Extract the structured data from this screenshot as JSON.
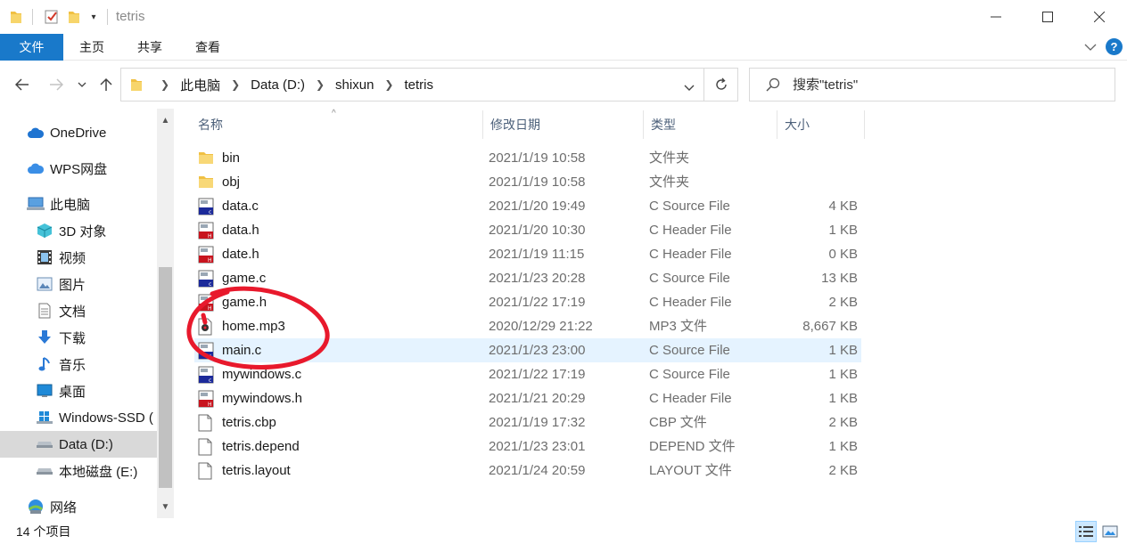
{
  "window": {
    "title": "tetris",
    "minimize_icon": "minimize-icon",
    "maximize_icon": "maximize-icon",
    "close_icon": "close-icon"
  },
  "ribbon": {
    "tabs": [
      {
        "label": "文件"
      },
      {
        "label": "主页"
      },
      {
        "label": "共享"
      },
      {
        "label": "查看"
      }
    ]
  },
  "address": {
    "crumbs": [
      "此电脑",
      "Data (D:)",
      "shixun",
      "tetris"
    ]
  },
  "search": {
    "placeholder": "搜索\"tetris\""
  },
  "sidebar": {
    "items": [
      {
        "label": "OneDrive",
        "icon": "cloud-icon"
      },
      {
        "label": "WPS网盘",
        "icon": "cloud-icon"
      },
      {
        "label": "此电脑",
        "icon": "computer-icon"
      },
      {
        "label": "3D 对象",
        "icon": "cube-icon"
      },
      {
        "label": "视频",
        "icon": "film-icon"
      },
      {
        "label": "图片",
        "icon": "picture-icon"
      },
      {
        "label": "文档",
        "icon": "document-icon"
      },
      {
        "label": "下载",
        "icon": "download-icon"
      },
      {
        "label": "音乐",
        "icon": "music-icon"
      },
      {
        "label": "桌面",
        "icon": "desktop-icon"
      },
      {
        "label": "Windows-SSD (",
        "icon": "windows-drive-icon"
      },
      {
        "label": "Data (D:)",
        "icon": "drive-icon"
      },
      {
        "label": "本地磁盘 (E:)",
        "icon": "drive-icon"
      },
      {
        "label": "网络",
        "icon": "network-icon"
      }
    ]
  },
  "columns": {
    "name": "名称",
    "date": "修改日期",
    "type": "类型",
    "size": "大小"
  },
  "files": [
    {
      "name": "bin",
      "date": "2021/1/19 10:58",
      "type": "文件夹",
      "size": "",
      "icon": "folder-icon"
    },
    {
      "name": "obj",
      "date": "2021/1/19 10:58",
      "type": "文件夹",
      "size": "",
      "icon": "folder-icon"
    },
    {
      "name": "data.c",
      "date": "2021/1/20 19:49",
      "type": "C Source File",
      "size": "4 KB",
      "icon": "c-source-icon"
    },
    {
      "name": "data.h",
      "date": "2021/1/20 10:30",
      "type": "C Header File",
      "size": "1 KB",
      "icon": "c-header-icon"
    },
    {
      "name": "date.h",
      "date": "2021/1/19 11:15",
      "type": "C Header File",
      "size": "0 KB",
      "icon": "c-header-icon"
    },
    {
      "name": "game.c",
      "date": "2021/1/23 20:28",
      "type": "C Source File",
      "size": "13 KB",
      "icon": "c-source-icon"
    },
    {
      "name": "game.h",
      "date": "2021/1/22 17:19",
      "type": "C Header File",
      "size": "2 KB",
      "icon": "c-header-icon"
    },
    {
      "name": "home.mp3",
      "date": "2020/12/29 21:22",
      "type": "MP3 文件",
      "size": "8,667 KB",
      "icon": "audio-file-icon"
    },
    {
      "name": "main.c",
      "date": "2021/1/23 23:00",
      "type": "C Source File",
      "size": "1 KB",
      "icon": "c-source-icon"
    },
    {
      "name": "mywindows.c",
      "date": "2021/1/22 17:19",
      "type": "C Source File",
      "size": "1 KB",
      "icon": "c-source-icon"
    },
    {
      "name": "mywindows.h",
      "date": "2021/1/21 20:29",
      "type": "C Header File",
      "size": "1 KB",
      "icon": "c-header-icon"
    },
    {
      "name": "tetris.cbp",
      "date": "2021/1/19 17:32",
      "type": "CBP 文件",
      "size": "2 KB",
      "icon": "blank-file-icon"
    },
    {
      "name": "tetris.depend",
      "date": "2021/1/23 23:01",
      "type": "DEPEND 文件",
      "size": "1 KB",
      "icon": "blank-file-icon"
    },
    {
      "name": "tetris.layout",
      "date": "2021/1/24 20:59",
      "type": "LAYOUT 文件",
      "size": "2 KB",
      "icon": "blank-file-icon"
    }
  ],
  "status": {
    "item_count": "14 个项目"
  },
  "colors": {
    "accent": "#1979ca",
    "annotation": "#e8192c",
    "selected_row": "#e5f3ff"
  }
}
